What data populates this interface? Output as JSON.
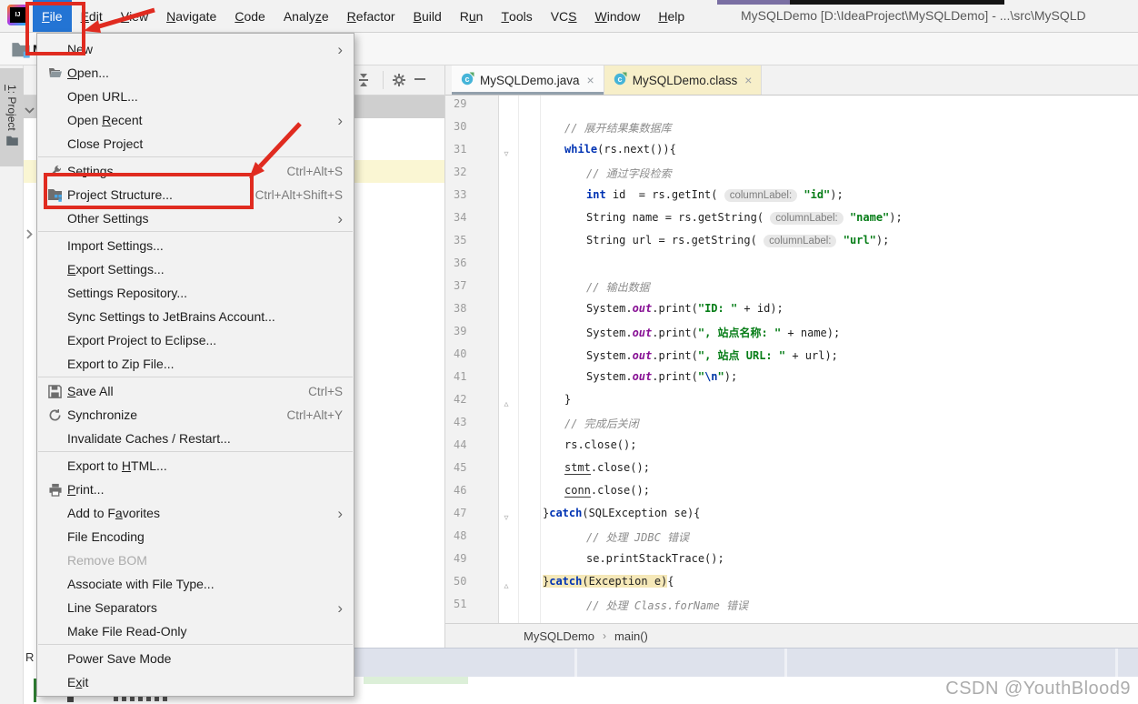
{
  "colors": {
    "annotation": "#E02B20",
    "accent_blue": "#2374D4"
  },
  "titlebar": {
    "title": "MySQLDemo [D:\\IdeaProject\\MySQLDemo] - ...\\src\\MySQLD",
    "menus": [
      {
        "label": "File",
        "mn": 0,
        "active": true
      },
      {
        "label": "Edit",
        "mn": 0
      },
      {
        "label": "View",
        "mn": 0
      },
      {
        "label": "Navigate",
        "mn": 0
      },
      {
        "label": "Code",
        "mn": 0
      },
      {
        "label": "Analyze",
        "mn": 5
      },
      {
        "label": "Refactor",
        "mn": 0
      },
      {
        "label": "Build",
        "mn": 0
      },
      {
        "label": "Run",
        "mn": 1
      },
      {
        "label": "Tools",
        "mn": 0
      },
      {
        "label": "VCS",
        "mn": 2
      },
      {
        "label": "Window",
        "mn": 0
      },
      {
        "label": "Help",
        "mn": 0
      }
    ]
  },
  "left_stripe": {
    "tool_button": "1: Project",
    "mn": 0
  },
  "project_panel": {
    "visible_root_fragment": "M"
  },
  "run_fragment": "R",
  "file_menu": {
    "items": [
      {
        "label": "New",
        "sub": true
      },
      {
        "label": "Open...",
        "mn": 0,
        "icon": "folder-open"
      },
      {
        "label": "Open URL..."
      },
      {
        "label": "Open Recent",
        "mn": 5,
        "sub": true
      },
      {
        "label": "Close Project"
      },
      {
        "sep": true
      },
      {
        "label": "Settings...",
        "mn": 2,
        "icon": "wrench",
        "shortcut": "Ctrl+Alt+S"
      },
      {
        "label": "Project Structure...",
        "icon": "project-structure",
        "shortcut": "Ctrl+Alt+Shift+S"
      },
      {
        "label": "Other Settings",
        "sub": true
      },
      {
        "sep": true
      },
      {
        "label": "Import Settings..."
      },
      {
        "label": "Export Settings...",
        "mn": 0
      },
      {
        "label": "Settings Repository..."
      },
      {
        "label": "Sync Settings to JetBrains Account..."
      },
      {
        "label": "Export Project to Eclipse..."
      },
      {
        "label": "Export to Zip File..."
      },
      {
        "sep": true
      },
      {
        "label": "Save All",
        "mn": 0,
        "icon": "floppy",
        "shortcut": "Ctrl+S"
      },
      {
        "label": "Synchronize",
        "icon": "sync",
        "shortcut": "Ctrl+Alt+Y"
      },
      {
        "label": "Invalidate Caches / Restart..."
      },
      {
        "sep": true
      },
      {
        "label": "Export to HTML...",
        "mn": 10
      },
      {
        "label": "Print...",
        "mn": 0,
        "icon": "printer"
      },
      {
        "label": "Add to Favorites",
        "mn": 8,
        "sub": true
      },
      {
        "label": "File Encoding"
      },
      {
        "label": "Remove BOM",
        "disabled": true
      },
      {
        "label": "Associate with File Type..."
      },
      {
        "label": "Line Separators",
        "sub": true
      },
      {
        "label": "Make File Read-Only"
      },
      {
        "sep": true
      },
      {
        "label": "Power Save Mode"
      },
      {
        "label": "Exit",
        "mn": 1
      }
    ]
  },
  "tabs": [
    {
      "label": "MySQLDemo.java",
      "close": "×",
      "active": true
    },
    {
      "label": "MySQLDemo.class",
      "close": "×",
      "active": false
    }
  ],
  "editor": {
    "lines": [
      {
        "n": 29,
        "i": 0,
        "f": "",
        "t": []
      },
      {
        "n": 30,
        "i": 12,
        "f": "",
        "t": [
          [
            "c",
            "// 展开结果集数据库"
          ]
        ]
      },
      {
        "n": 31,
        "i": 12,
        "f": "open",
        "t": [
          [
            "k",
            "while"
          ],
          [
            "p",
            "(rs.next()){"
          ]
        ]
      },
      {
        "n": 32,
        "i": 16,
        "f": "",
        "t": [
          [
            "c",
            "// 通过字段检索"
          ]
        ]
      },
      {
        "n": 33,
        "i": 16,
        "f": "",
        "t": [
          [
            "k",
            "int"
          ],
          [
            "p",
            " id  = rs.getInt( "
          ],
          [
            "h",
            "columnLabel:"
          ],
          [
            "p",
            " "
          ],
          [
            "s",
            "\"id\""
          ],
          [
            "p",
            ");"
          ]
        ]
      },
      {
        "n": 34,
        "i": 16,
        "f": "",
        "t": [
          [
            "p",
            "String name = rs.getString( "
          ],
          [
            "h",
            "columnLabel:"
          ],
          [
            "p",
            " "
          ],
          [
            "s",
            "\"name\""
          ],
          [
            "p",
            ");"
          ]
        ]
      },
      {
        "n": 35,
        "i": 16,
        "f": "",
        "t": [
          [
            "p",
            "String url = rs.getString( "
          ],
          [
            "h",
            "columnLabel:"
          ],
          [
            "p",
            " "
          ],
          [
            "s",
            "\"url\""
          ],
          [
            "p",
            ");"
          ]
        ]
      },
      {
        "n": 36,
        "i": 0,
        "f": "",
        "t": []
      },
      {
        "n": 37,
        "i": 16,
        "f": "",
        "t": [
          [
            "c",
            "// 输出数据"
          ]
        ]
      },
      {
        "n": 38,
        "i": 16,
        "f": "",
        "t": [
          [
            "p",
            "System."
          ],
          [
            "f",
            "out"
          ],
          [
            "p",
            ".print("
          ],
          [
            "s",
            "\"ID: \""
          ],
          [
            "p",
            " + id);"
          ]
        ]
      },
      {
        "n": 39,
        "i": 16,
        "f": "",
        "t": [
          [
            "p",
            "System."
          ],
          [
            "f",
            "out"
          ],
          [
            "p",
            ".print("
          ],
          [
            "s",
            "\", 站点名称: \""
          ],
          [
            "p",
            " + name);"
          ]
        ]
      },
      {
        "n": 40,
        "i": 16,
        "f": "",
        "t": [
          [
            "p",
            "System."
          ],
          [
            "f",
            "out"
          ],
          [
            "p",
            ".print("
          ],
          [
            "s",
            "\", 站点 URL: \""
          ],
          [
            "p",
            " + url);"
          ]
        ]
      },
      {
        "n": 41,
        "i": 16,
        "f": "",
        "t": [
          [
            "p",
            "System."
          ],
          [
            "f",
            "out"
          ],
          [
            "p",
            ".print("
          ],
          [
            "s",
            "\""
          ],
          [
            "e",
            "\\n"
          ],
          [
            "s",
            "\""
          ],
          [
            "p",
            ");"
          ]
        ]
      },
      {
        "n": 42,
        "i": 12,
        "f": "close",
        "t": [
          [
            "p",
            "}"
          ]
        ]
      },
      {
        "n": 43,
        "i": 12,
        "f": "",
        "t": [
          [
            "c",
            "// 完成后关闭"
          ]
        ]
      },
      {
        "n": 44,
        "i": 12,
        "f": "",
        "t": [
          [
            "p",
            "rs.close();"
          ]
        ]
      },
      {
        "n": 45,
        "i": 12,
        "f": "",
        "t": [
          [
            "u",
            "stmt"
          ],
          [
            "p",
            ".close();"
          ]
        ]
      },
      {
        "n": 46,
        "i": 12,
        "f": "",
        "t": [
          [
            "u",
            "conn"
          ],
          [
            "p",
            ".close();"
          ]
        ]
      },
      {
        "n": 47,
        "i": 8,
        "f": "open",
        "t": [
          [
            "p",
            "}"
          ],
          [
            "k",
            "catch"
          ],
          [
            "p",
            "(SQLException se){"
          ]
        ]
      },
      {
        "n": 48,
        "i": 16,
        "f": "",
        "t": [
          [
            "c",
            "// 处理 JDBC 错误"
          ]
        ]
      },
      {
        "n": 49,
        "i": 16,
        "f": "",
        "t": [
          [
            "p",
            "se.printStackTrace();"
          ]
        ]
      },
      {
        "n": 50,
        "i": 8,
        "f": "close",
        "t": [
          [
            "p",
            "}",
            1
          ],
          [
            "k",
            "catch",
            1
          ],
          [
            "p",
            "(Exception e)",
            1
          ],
          [
            "p",
            "{"
          ]
        ]
      },
      {
        "n": 51,
        "i": 16,
        "f": "",
        "t": [
          [
            "c",
            "// 处理 Class.forName 错误"
          ]
        ]
      }
    ]
  },
  "breadcrumbs": {
    "items": [
      "MySQLDemo",
      "main()"
    ],
    "separator": "›"
  },
  "watermark": "CSDN @YouthBlood9"
}
